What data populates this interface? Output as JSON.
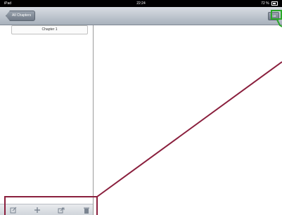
{
  "status_bar": {
    "carrier": "iPad",
    "time": "22:24",
    "battery": "72 %"
  },
  "nav_bar": {
    "back_label": "All Chapters",
    "right_button_label": "Edit"
  },
  "sidebar": {
    "items": [
      {
        "label": "Chapter 1"
      }
    ]
  },
  "toolbar": {
    "icons": [
      "compose-icon",
      "add-icon",
      "share-icon",
      "trash-icon"
    ]
  },
  "colors": {
    "callout_green": "#2aa829",
    "callout_maroon": "#8a1f3d",
    "nav_gradient_top": "#d8dde3",
    "nav_gradient_bottom": "#a8b1bc"
  }
}
